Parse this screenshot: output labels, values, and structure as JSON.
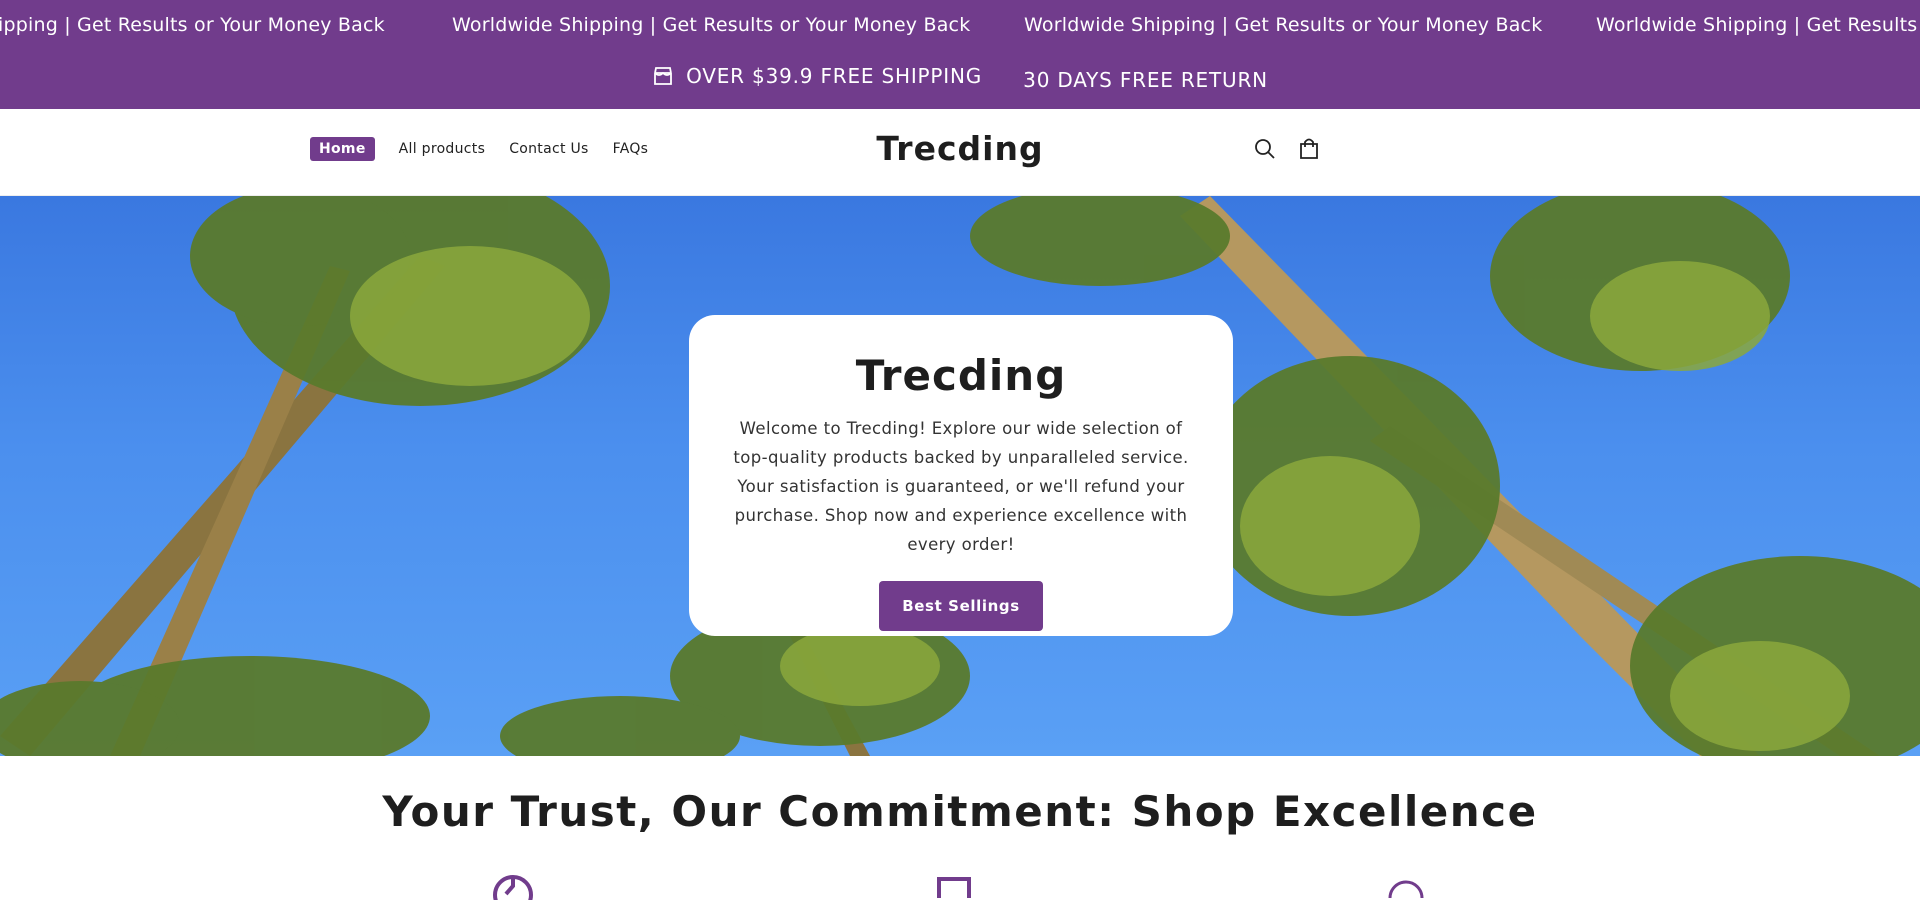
{
  "marquee": {
    "items": [
      "ipping | Get Results or Your Money Back",
      "Worldwide Shipping | Get Results or Your Money Back",
      "Worldwide Shipping | Get Results or Your Money Back",
      "Worldwide Shipping | Get Results or Your Money Back"
    ]
  },
  "announcement": {
    "shipping": "OVER $39.9 FREE SHIPPING",
    "returns": "30 DAYS FREE RETURN"
  },
  "nav": {
    "items": [
      "Home",
      "All products",
      "Contact Us",
      "FAQs"
    ],
    "active": "Home"
  },
  "brand": {
    "name": "Trecding"
  },
  "hero": {
    "title": "Trecding",
    "description": "Welcome to Trecding! Explore our wide selection of top-quality products backed by unparalleled service. Your satisfaction is guaranteed, or we'll refund your purchase. Shop now and experience excellence with every order!",
    "cta_label": "Best Sellings"
  },
  "trust": {
    "heading": "Your Trust, Our Commitment: Shop Excellence"
  },
  "colors": {
    "brand": "#713c8c",
    "sky": "#4b8fee"
  },
  "icons": [
    "store-icon",
    "search-icon",
    "cart-icon"
  ]
}
